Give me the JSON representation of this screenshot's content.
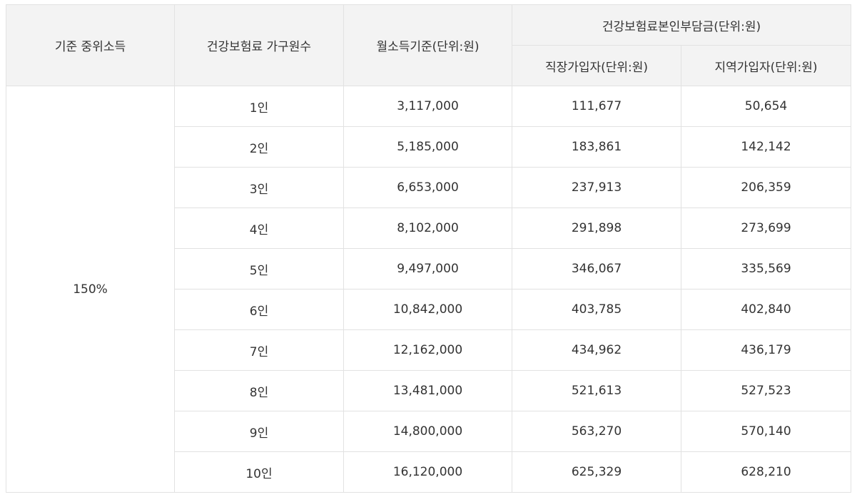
{
  "header": {
    "median_income": "기준 중위소득",
    "household_size": "건강보험료 가구원수",
    "monthly_income": "월소득기준(단위:원)",
    "premium_group": "건강보험료본인부담금(단위:원)",
    "employee": "직장가입자(단위:원)",
    "regional": "지역가입자(단위:원)"
  },
  "median_value": "150%",
  "rows": [
    {
      "household": "1인",
      "income": "3,117,000",
      "employee": "111,677",
      "regional": "50,654"
    },
    {
      "household": "2인",
      "income": "5,185,000",
      "employee": "183,861",
      "regional": "142,142"
    },
    {
      "household": "3인",
      "income": "6,653,000",
      "employee": "237,913",
      "regional": "206,359"
    },
    {
      "household": "4인",
      "income": "8,102,000",
      "employee": "291,898",
      "regional": "273,699"
    },
    {
      "household": "5인",
      "income": "9,497,000",
      "employee": "346,067",
      "regional": "335,569"
    },
    {
      "household": "6인",
      "income": "10,842,000",
      "employee": "403,785",
      "regional": "402,840"
    },
    {
      "household": "7인",
      "income": "12,162,000",
      "employee": "434,962",
      "regional": "436,179"
    },
    {
      "household": "8인",
      "income": "13,481,000",
      "employee": "521,613",
      "regional": "527,523"
    },
    {
      "household": "9인",
      "income": "14,800,000",
      "employee": "563,270",
      "regional": "570,140"
    },
    {
      "household": "10인",
      "income": "16,120,000",
      "employee": "625,329",
      "regional": "628,210"
    }
  ]
}
